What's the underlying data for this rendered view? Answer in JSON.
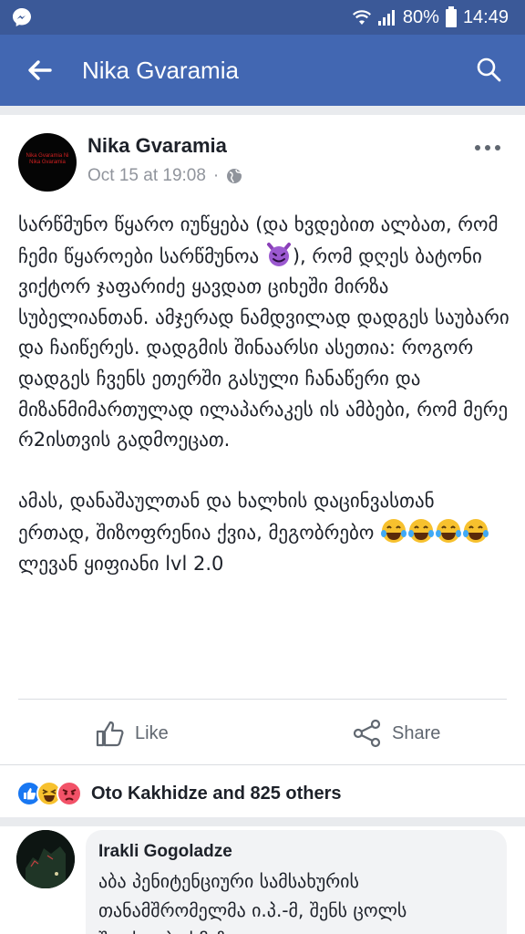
{
  "status_bar": {
    "battery": "80%",
    "time": "14:49",
    "icons": [
      "messenger-icon",
      "wifi-icon",
      "signal-icon",
      "battery-icon"
    ]
  },
  "app_bar": {
    "title": "Nika Gvaramia",
    "icons": [
      "back-arrow-icon",
      "search-icon"
    ]
  },
  "post": {
    "author": "Nika Gvaramia",
    "timestamp": "Oct 15 at 19:08",
    "separator": "·",
    "privacy_icon": "globe-icon",
    "avatar_text": "Nika Gvaramia Ni Nika Gvaramia",
    "text": {
      "p1_part1": "სარწმუნო წყარო იუწყება (და ხვდებით ალბათ, რომ ჩემი წყაროები სარწმუნოა ",
      "p1_part2": "), რომ დღეს ბატონი ვიქტორ ჯაფარიძე ყავდათ ციხეში მირზა სუბელიანთან. ამჯერად ნამდვილად დადგეს საუბარი და ჩაიწერეს. დადგმის შინაარსი ასეთია: როგორ დადგეს ჩვენს ეთერში გასული ჩანაწერი და მიზანმიმართულად ილაპარაკეს ის ამბები, რომ მერე რ2ისთვის გადმოეცათ.",
      "p2_part1": "ამას, დანაშაულთან და ხალხის დაცინვასთან ერთად, შიზოფრენია ქვია, მეგობრებო ",
      "p2_part2": " ლევან ყიფიანი lvl 2.0"
    },
    "emojis": [
      "smiling-imp-icon",
      "tears-of-joy-icon",
      "tears-of-joy-icon",
      "tears-of-joy-icon",
      "tears-of-joy-icon"
    ]
  },
  "actions": {
    "like_label": "Like",
    "share_label": "Share"
  },
  "reactions": {
    "summary": "Oto Kakhidze and 825 others",
    "icons": [
      "like-reaction-icon",
      "haha-reaction-icon",
      "angry-reaction-icon"
    ]
  },
  "comment": {
    "author": "Irakli Gogoladze",
    "text": "აბა პენიტენციური სამსახურის თანამშრომელმა ი.პ.-მ, შენს ცოლს შეიძლება ხმაზე"
  },
  "colors": {
    "status_bar": "#3b5998",
    "app_bar": "#4267b2",
    "background": "#e9ebee",
    "meta_text": "#90949c",
    "action_text": "#606770",
    "like_blue": "#1877f2",
    "angry_red": "#f25268"
  }
}
